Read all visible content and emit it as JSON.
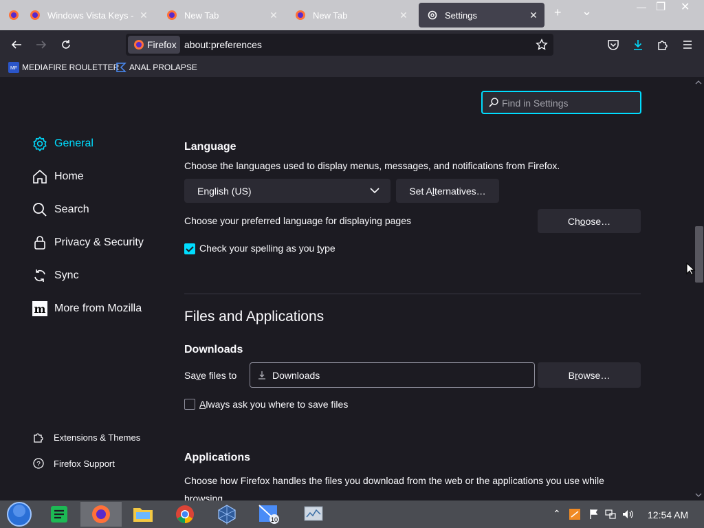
{
  "tabs": [
    {
      "title": "Windows Vista Keys - Lawrence",
      "active": false
    },
    {
      "title": "New Tab",
      "active": false
    },
    {
      "title": "New Tab",
      "active": false
    },
    {
      "title": "Settings",
      "active": true
    }
  ],
  "window_controls": {
    "new_tab": "+",
    "list_all": "⌄",
    "minimize": "—",
    "restore": "❐",
    "close": "✕"
  },
  "nav": {
    "identity_label": "Firefox",
    "url": "about:preferences"
  },
  "bookmarks": [
    {
      "label": "MEDIAFIRE ROULETTER"
    },
    {
      "label": "ANAL PROLAPSE"
    }
  ],
  "search": {
    "placeholder": "Find in Settings"
  },
  "sidebar": {
    "categories": [
      {
        "label": "General",
        "icon": "gear-icon",
        "selected": true
      },
      {
        "label": "Home",
        "icon": "home-icon"
      },
      {
        "label": "Search",
        "icon": "search-icon"
      },
      {
        "label": "Privacy & Security",
        "icon": "lock-icon"
      },
      {
        "label": "Sync",
        "icon": "sync-icon"
      },
      {
        "label": "More from Mozilla",
        "icon": "mozilla-icon"
      }
    ],
    "footer": [
      {
        "label": "Extensions & Themes",
        "icon": "puzzle-icon"
      },
      {
        "label": "Firefox Support",
        "icon": "help-icon"
      }
    ]
  },
  "language": {
    "heading": "Language",
    "description": "Choose the languages used to display menus, messages, and notifications from Firefox.",
    "selected": "English (US)",
    "set_alternatives_pre": "Set A",
    "set_alternatives_key": "l",
    "set_alternatives_post": "ternatives…",
    "pages_text": "Choose your preferred language for displaying pages",
    "choose_pre": "Ch",
    "choose_key": "o",
    "choose_post": "ose…",
    "spell_pre": "Check your spelling as you ",
    "spell_key": "t",
    "spell_post": "ype",
    "spell_checked": true
  },
  "files_apps": {
    "heading": "Files and Applications",
    "downloads_heading": "Downloads",
    "save_pre": "Sa",
    "save_key": "v",
    "save_post": "e files to",
    "folder": "Downloads",
    "browse_pre": "B",
    "browse_key": "r",
    "browse_post": "owse…",
    "always_ask_key": "A",
    "always_ask_post": "lways ask you where to save files",
    "always_ask_checked": false,
    "applications_heading": "Applications",
    "applications_desc": "Choose how Firefox handles the files you download from the web or the applications you use while browsing."
  },
  "taskbar": {
    "apps": [
      "start-orb",
      "spreadsheet-app",
      "firefox",
      "file-explorer",
      "chrome",
      "virtualbox",
      "windows-10-app",
      "monitor-app"
    ],
    "clock": "12:54 AM"
  }
}
